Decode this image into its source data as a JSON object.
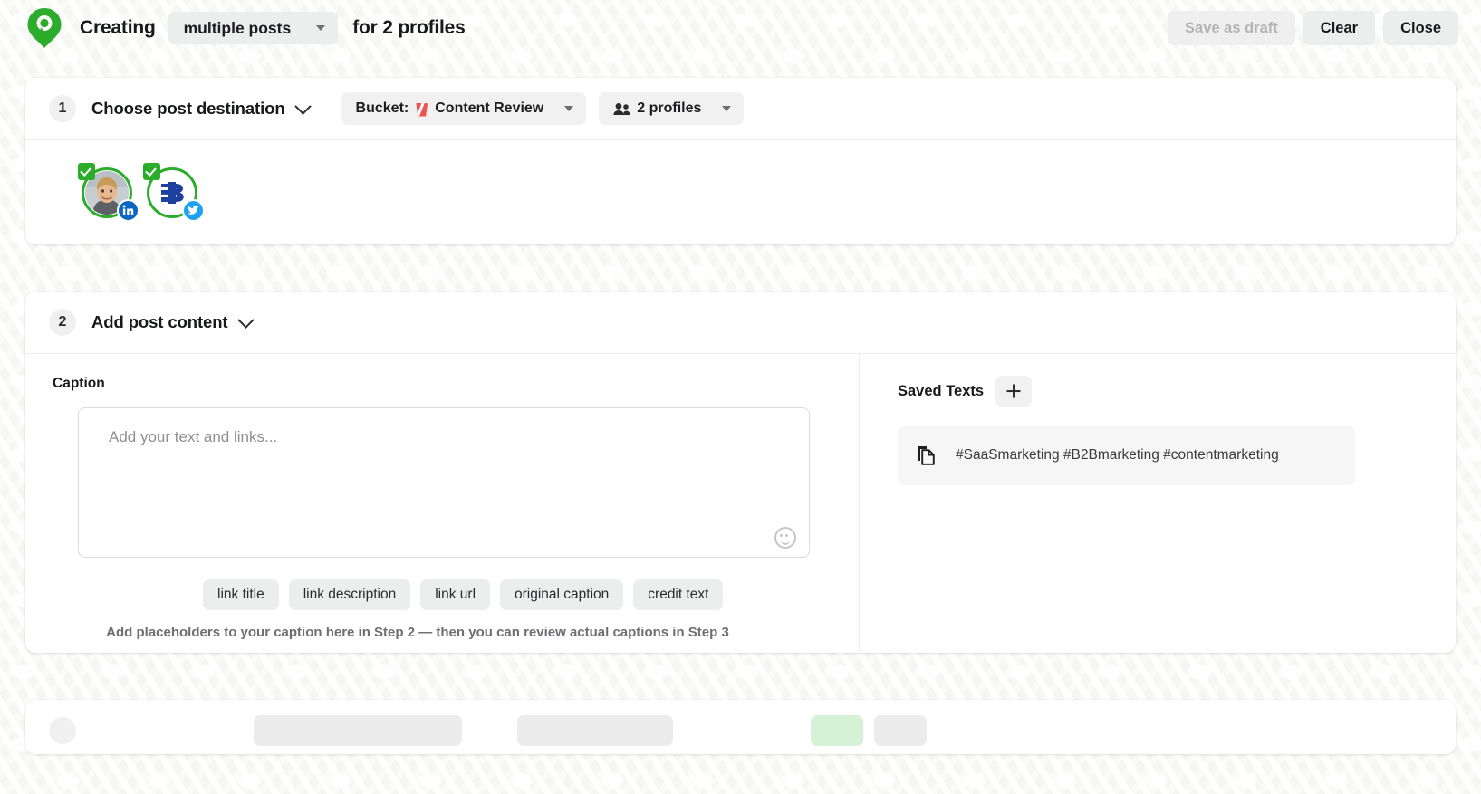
{
  "header": {
    "logo_icon": "location-pin-logo",
    "creating_label": "Creating",
    "post_type": "multiple posts",
    "for_label": "for 2 profiles",
    "save_draft_label": "Save as draft",
    "clear_label": "Clear",
    "close_label": "Close"
  },
  "step1": {
    "number": "1",
    "title": "Choose post destination",
    "bucket_prefix": "Bucket:",
    "bucket_name": "Content Review",
    "bucket_emoji": "red-cup-emoji",
    "profiles_label": "2 profiles",
    "profiles_icon": "people-icon",
    "profiles": [
      {
        "name": "profile-avatar-person",
        "network": "linkedin",
        "selected": true
      },
      {
        "name": "profile-avatar-brand",
        "network": "twitter",
        "selected": true
      }
    ]
  },
  "step2": {
    "number": "2",
    "title": "Add post content",
    "caption_label": "Caption",
    "caption_value": "",
    "caption_placeholder": "Add your text and links...",
    "emoji_icon": "smiley-icon",
    "placeholders": [
      "link title",
      "link description",
      "link url",
      "original caption",
      "credit text"
    ],
    "hint": "Add placeholders to your caption here in Step 2 — then you can review actual captions in Step 3",
    "saved": {
      "title": "Saved Texts",
      "add_label": "+",
      "items": [
        {
          "text": "#SaaSmarketing #B2Bmarketing #contentmarketing",
          "icon": "copy-icon"
        }
      ]
    }
  },
  "colors": {
    "brand_green": "#2bad2b",
    "linkedin": "#0a66c2",
    "twitter": "#1da1f2",
    "bucket_red": "#ef5350",
    "page_bg": "#f7f7f6",
    "card_bg": "#ffffff"
  }
}
